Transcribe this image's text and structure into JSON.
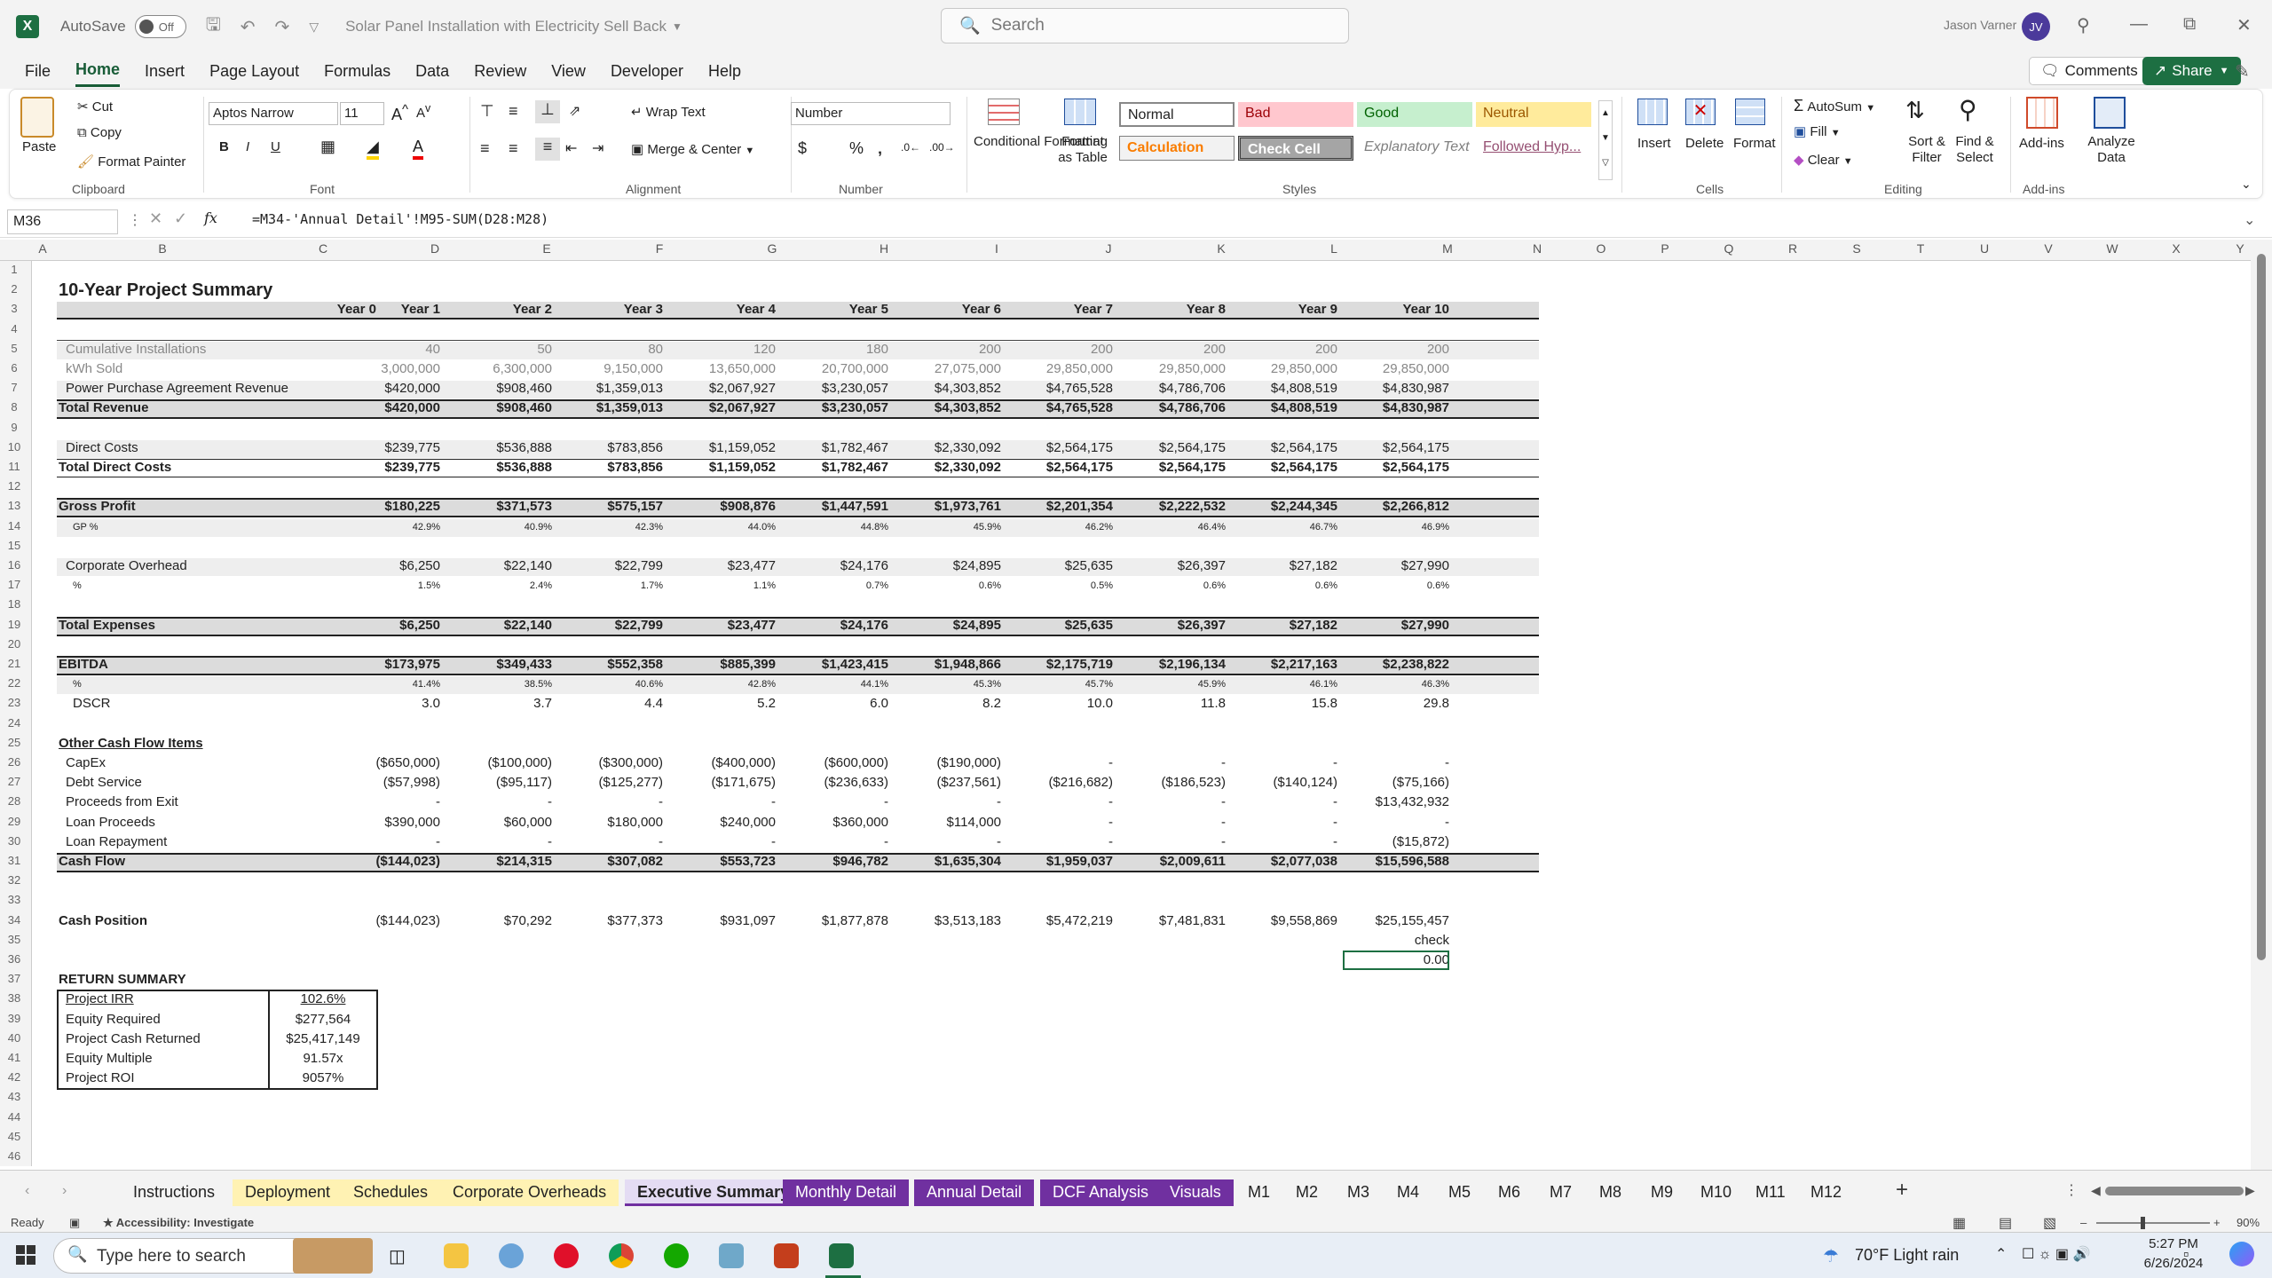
{
  "app": {
    "autosave_label": "AutoSave",
    "autosave_state": "Off",
    "doc_title": "Solar Panel Installation with Electricity Sell Back",
    "search_placeholder": "Search",
    "user_name": "Jason Varner",
    "user_initials": "JV"
  },
  "menu": [
    "File",
    "Home",
    "Insert",
    "Page Layout",
    "Formulas",
    "Data",
    "Review",
    "View",
    "Developer",
    "Help"
  ],
  "menu_active": "Home",
  "top_buttons": {
    "comments": "Comments",
    "share": "Share"
  },
  "ribbon": {
    "clipboard": {
      "paste": "Paste",
      "cut": "Cut",
      "copy": "Copy",
      "format_painter": "Format Painter",
      "label": "Clipboard"
    },
    "font": {
      "name": "Aptos Narrow",
      "size": "11",
      "label": "Font"
    },
    "alignment": {
      "wrap": "Wrap Text",
      "merge": "Merge & Center",
      "label": "Alignment"
    },
    "number": {
      "format": "Number",
      "label": "Number"
    },
    "styles": {
      "conditional": "Conditional Formatting",
      "format_table": "Format as Table",
      "cells": [
        "Normal",
        "Bad",
        "Good",
        "Neutral",
        "Calculation",
        "Check Cell",
        "Explanatory Text",
        "Followed Hyp..."
      ],
      "label": "Styles"
    },
    "cells": {
      "insert": "Insert",
      "delete": "Delete",
      "format": "Format",
      "label": "Cells"
    },
    "editing": {
      "autosum": "AutoSum",
      "fill": "Fill",
      "clear": "Clear",
      "sort": "Sort & Filter",
      "find": "Find & Select",
      "label": "Editing"
    },
    "addins": {
      "addins": "Add-ins",
      "analyze": "Analyze Data",
      "label": "Add-ins"
    }
  },
  "formula_bar": {
    "name_box": "M36",
    "formula": "=M34-'Annual Detail'!M95-SUM(D28:M28)"
  },
  "columns": [
    "A",
    "B",
    "C",
    "D",
    "E",
    "F",
    "G",
    "H",
    "I",
    "J",
    "K",
    "L",
    "M",
    "N",
    "O",
    "P",
    "Q",
    "R",
    "S",
    "T",
    "U",
    "V",
    "W",
    "X",
    "Y"
  ],
  "rows": [
    "1",
    "2",
    "3",
    "4",
    "5",
    "6",
    "7",
    "8",
    "9",
    "10",
    "11",
    "12",
    "13",
    "14",
    "15",
    "16",
    "17",
    "18",
    "19",
    "20",
    "21",
    "22",
    "23",
    "24",
    "25",
    "26",
    "27",
    "28",
    "29",
    "30",
    "31",
    "32",
    "33",
    "34",
    "35",
    "36",
    "37",
    "38",
    "39",
    "40",
    "41",
    "42",
    "43",
    "44",
    "45",
    "46"
  ],
  "sheet": {
    "title": "10-Year Project Summary",
    "years": [
      "Year 0",
      "Year 1",
      "Year 2",
      "Year 3",
      "Year 4",
      "Year 5",
      "Year 6",
      "Year 7",
      "Year 8",
      "Year 9",
      "Year 10"
    ],
    "rows": [
      {
        "row": 5,
        "label": "Cumulative Installations",
        "style": "grey",
        "values": [
          "40",
          "50",
          "80",
          "120",
          "180",
          "200",
          "200",
          "200",
          "200",
          "200"
        ]
      },
      {
        "row": 6,
        "label": "kWh Sold",
        "style": "grey",
        "values": [
          "3,000,000",
          "6,300,000",
          "9,150,000",
          "13,650,000",
          "20,700,000",
          "27,075,000",
          "29,850,000",
          "29,850,000",
          "29,850,000",
          "29,850,000"
        ]
      },
      {
        "row": 7,
        "label": "Power Purchase Agreement Revenue",
        "style": "",
        "values": [
          "$420,000",
          "$908,460",
          "$1,359,013",
          "$2,067,927",
          "$3,230,057",
          "$4,303,852",
          "$4,765,528",
          "$4,786,706",
          "$4,808,519",
          "$4,830,987"
        ]
      },
      {
        "row": 8,
        "label": "Total Revenue",
        "style": "total",
        "values": [
          "$420,000",
          "$908,460",
          "$1,359,013",
          "$2,067,927",
          "$3,230,057",
          "$4,303,852",
          "$4,765,528",
          "$4,786,706",
          "$4,808,519",
          "$4,830,987"
        ]
      },
      {
        "row": 10,
        "label": "Direct Costs",
        "style": "",
        "values": [
          "$239,775",
          "$536,888",
          "$783,856",
          "$1,159,052",
          "$1,782,467",
          "$2,330,092",
          "$2,564,175",
          "$2,564,175",
          "$2,564,175",
          "$2,564,175"
        ]
      },
      {
        "row": 11,
        "label": "Total Direct Costs",
        "style": "totalline",
        "values": [
          "$239,775",
          "$536,888",
          "$783,856",
          "$1,159,052",
          "$1,782,467",
          "$2,330,092",
          "$2,564,175",
          "$2,564,175",
          "$2,564,175",
          "$2,564,175"
        ]
      },
      {
        "row": 13,
        "label": "Gross Profit",
        "style": "total",
        "values": [
          "$180,225",
          "$371,573",
          "$575,157",
          "$908,876",
          "$1,447,591",
          "$1,973,761",
          "$2,201,354",
          "$2,222,532",
          "$2,244,345",
          "$2,266,812"
        ]
      },
      {
        "row": 14,
        "label": "GP %",
        "style": "pct",
        "values": [
          "42.9%",
          "40.9%",
          "42.3%",
          "44.0%",
          "44.8%",
          "45.9%",
          "46.2%",
          "46.4%",
          "46.7%",
          "46.9%"
        ]
      },
      {
        "row": 16,
        "label": "Corporate Overhead",
        "style": "",
        "values": [
          "$6,250",
          "$22,140",
          "$22,799",
          "$23,477",
          "$24,176",
          "$24,895",
          "$25,635",
          "$26,397",
          "$27,182",
          "$27,990"
        ]
      },
      {
        "row": 17,
        "label": "%",
        "style": "pct",
        "values": [
          "1.5%",
          "2.4%",
          "1.7%",
          "1.1%",
          "0.7%",
          "0.6%",
          "0.5%",
          "0.6%",
          "0.6%",
          "0.6%"
        ]
      },
      {
        "row": 19,
        "label": "Total Expenses",
        "style": "total",
        "values": [
          "$6,250",
          "$22,140",
          "$22,799",
          "$23,477",
          "$24,176",
          "$24,895",
          "$25,635",
          "$26,397",
          "$27,182",
          "$27,990"
        ]
      },
      {
        "row": 21,
        "label": "EBITDA",
        "style": "total",
        "values": [
          "$173,975",
          "$349,433",
          "$552,358",
          "$885,399",
          "$1,423,415",
          "$1,948,866",
          "$2,175,719",
          "$2,196,134",
          "$2,217,163",
          "$2,238,822"
        ]
      },
      {
        "row": 22,
        "label": "%",
        "style": "pct",
        "values": [
          "41.4%",
          "38.5%",
          "40.6%",
          "42.8%",
          "44.1%",
          "45.3%",
          "45.7%",
          "45.9%",
          "46.1%",
          "46.3%"
        ]
      },
      {
        "row": 23,
        "label": "DSCR",
        "style": "dscr",
        "values": [
          "3.0",
          "3.7",
          "4.4",
          "5.2",
          "6.0",
          "8.2",
          "10.0",
          "11.8",
          "15.8",
          "29.8"
        ]
      },
      {
        "row": 25,
        "label": "Other Cash Flow Items",
        "style": "heading",
        "values": []
      },
      {
        "row": 26,
        "label": "CapEx",
        "style": "",
        "values": [
          "($650,000)",
          "($100,000)",
          "($300,000)",
          "($400,000)",
          "($600,000)",
          "($190,000)",
          "-",
          "-",
          "-",
          "-"
        ]
      },
      {
        "row": 27,
        "label": "Debt Service",
        "style": "",
        "values": [
          "($57,998)",
          "($95,117)",
          "($125,277)",
          "($171,675)",
          "($236,633)",
          "($237,561)",
          "($216,682)",
          "($186,523)",
          "($140,124)",
          "($75,166)"
        ]
      },
      {
        "row": 28,
        "label": "Proceeds from Exit",
        "style": "",
        "values": [
          "-",
          "-",
          "-",
          "-",
          "-",
          "-",
          "-",
          "-",
          "-",
          "$13,432,932"
        ]
      },
      {
        "row": 29,
        "label": "Loan Proceeds",
        "style": "",
        "values": [
          "$390,000",
          "$60,000",
          "$180,000",
          "$240,000",
          "$360,000",
          "$114,000",
          "-",
          "-",
          "-",
          "-"
        ]
      },
      {
        "row": 30,
        "label": "Loan Repayment",
        "style": "",
        "values": [
          "-",
          "-",
          "-",
          "-",
          "-",
          "-",
          "-",
          "-",
          "-",
          "($15,872)"
        ]
      },
      {
        "row": 31,
        "label": "Cash Flow",
        "style": "total",
        "values": [
          "($144,023)",
          "$214,315",
          "$307,082",
          "$553,723",
          "$946,782",
          "$1,635,304",
          "$1,959,037",
          "$2,009,611",
          "$2,077,038",
          "$15,596,588"
        ]
      },
      {
        "row": 34,
        "label": "Cash Position",
        "style": "boldlabel",
        "values": [
          "($144,023)",
          "$70,292",
          "$377,373",
          "$931,097",
          "$1,877,878",
          "$3,513,183",
          "$5,472,219",
          "$7,481,831",
          "$9,558,869",
          "$25,155,457"
        ]
      }
    ],
    "check_label": "check",
    "check_value": "0.00",
    "return_summary": {
      "title": "RETURN SUMMARY",
      "items": [
        {
          "label": "Project IRR",
          "value": "102.6%"
        },
        {
          "label": "Equity Required",
          "value": "$277,564"
        },
        {
          "label": "Project Cash Returned",
          "value": "$25,417,149"
        },
        {
          "label": "Equity Multiple",
          "value": "91.57x"
        },
        {
          "label": "Project ROI",
          "value": "9057%"
        }
      ]
    }
  },
  "tabs": [
    {
      "label": "Instructions",
      "color": "none"
    },
    {
      "label": "Deployment",
      "color": "#fff2b3"
    },
    {
      "label": "Schedules",
      "color": "#fff2b3"
    },
    {
      "label": "Corporate Overheads",
      "color": "#fff2b3"
    },
    {
      "label": "Executive Summary",
      "color": "#e4dcf3"
    },
    {
      "label": "Monthly Detail",
      "color": "#7030a0"
    },
    {
      "label": "Annual Detail",
      "color": "#7030a0"
    },
    {
      "label": "DCF Analysis",
      "color": "#7030a0"
    },
    {
      "label": "Visuals",
      "color": "#7030a0"
    },
    {
      "label": "M1",
      "color": "none"
    },
    {
      "label": "M2",
      "color": "none"
    },
    {
      "label": "M3",
      "color": "none"
    },
    {
      "label": "M4",
      "color": "none"
    },
    {
      "label": "M5",
      "color": "none"
    },
    {
      "label": "M6",
      "color": "none"
    },
    {
      "label": "M7",
      "color": "none"
    },
    {
      "label": "M8",
      "color": "none"
    },
    {
      "label": "M9",
      "color": "none"
    },
    {
      "label": "M10",
      "color": "none"
    },
    {
      "label": "M11",
      "color": "none"
    },
    {
      "label": "M12",
      "color": "none"
    }
  ],
  "active_tab": "Executive Summary",
  "status": {
    "ready": "Ready",
    "accessibility": "Accessibility: Investigate",
    "zoom": "90%"
  },
  "taskbar": {
    "search_placeholder": "Type here to search",
    "weather": "70°F  Light rain",
    "time": "5:27 PM",
    "date": "6/26/2024"
  }
}
